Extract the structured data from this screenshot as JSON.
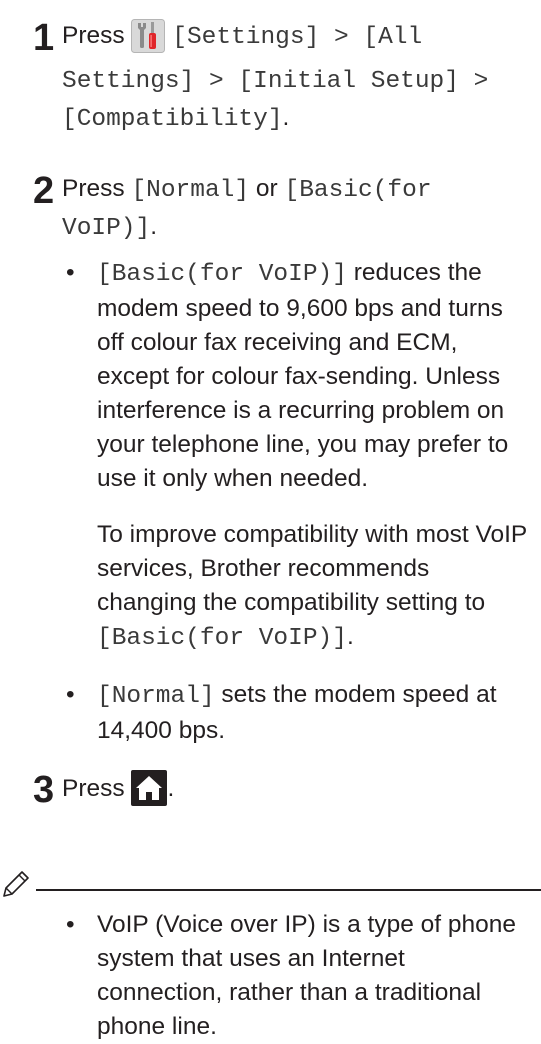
{
  "step1": {
    "number": "1",
    "press": "Press",
    "settings_path_a": "[Settings] > [All",
    "settings_path_b": "Settings] > [Initial Setup] >",
    "settings_path_c": "[Compatibility]",
    "period": "."
  },
  "step2": {
    "number": "2",
    "press": "Press",
    "opt_normal": "[Normal]",
    "or": "or",
    "opt_basic_a": "[Basic(for",
    "opt_basic_b": "VoIP)]",
    "period": ".",
    "bullets": {
      "basic_label": "[Basic(for VoIP)]",
      "basic_desc": " reduces the modem speed to 9,600 bps and turns off colour fax receiving and ECM, except for colour fax-sending. Unless interference is a recurring problem on your telephone line, you may prefer to use it only when needed.",
      "basic_para": "To improve compatibility with most VoIP services, Brother recommends changing the compatibility setting to ",
      "basic_para_value": "[Basic(for VoIP)]",
      "normal_label": "[Normal]",
      "normal_desc": " sets the modem speed at 14,400 bps."
    }
  },
  "step3": {
    "number": "3",
    "press": "Press",
    "period": "."
  },
  "note": {
    "text": "VoIP (Voice over IP) is a type of phone system that uses an Internet connection, rather than a traditional phone line."
  },
  "icons": {
    "settings": "settings-icon",
    "home": "home-icon",
    "note": "pencil-icon"
  }
}
